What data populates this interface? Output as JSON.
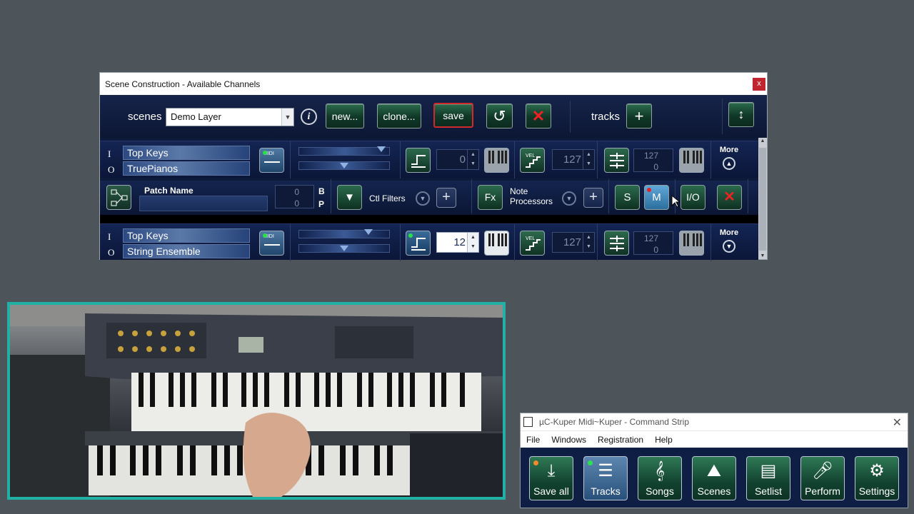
{
  "scene_window": {
    "title": "Scene Construction - Available Channels",
    "close_label": "x",
    "toolbar": {
      "scenes_label": "scenes",
      "scene_selected": "Demo Layer",
      "new_label": "new...",
      "clone_label": "clone...",
      "save_label": "save",
      "tracks_label": "tracks"
    },
    "channels": [
      {
        "in_label": "I",
        "out_label": "O",
        "input_name": "Top Keys",
        "output_name": "TruePianos",
        "transpose": "0",
        "velocity": "127",
        "range_high": "127",
        "range_low": "0",
        "more_label": "More"
      },
      {
        "in_label": "I",
        "out_label": "O",
        "input_name": "Top Keys",
        "output_name": "String Ensemble",
        "transpose": "12",
        "velocity": "127",
        "range_high": "127",
        "range_low": "0",
        "more_label": "More"
      }
    ],
    "patch": {
      "patch_name_label": "Patch Name",
      "bank_value": "0",
      "program_value": "0",
      "bank_letter": "B",
      "program_letter": "P",
      "ctl_filters_label": "Ctl Filters",
      "fx_label": "Fx",
      "note_processors_label": "Note Processors",
      "solo_label": "S",
      "mute_label": "M",
      "io_label": "I/O"
    }
  },
  "command_strip": {
    "title": "µC-Kuper Midi~Kuper - Command Strip",
    "menu": [
      "File",
      "Windows",
      "Registration",
      "Help"
    ],
    "buttons": [
      "Save all",
      "Tracks",
      "Songs",
      "Scenes",
      "Setlist",
      "Perform",
      "Settings"
    ]
  }
}
